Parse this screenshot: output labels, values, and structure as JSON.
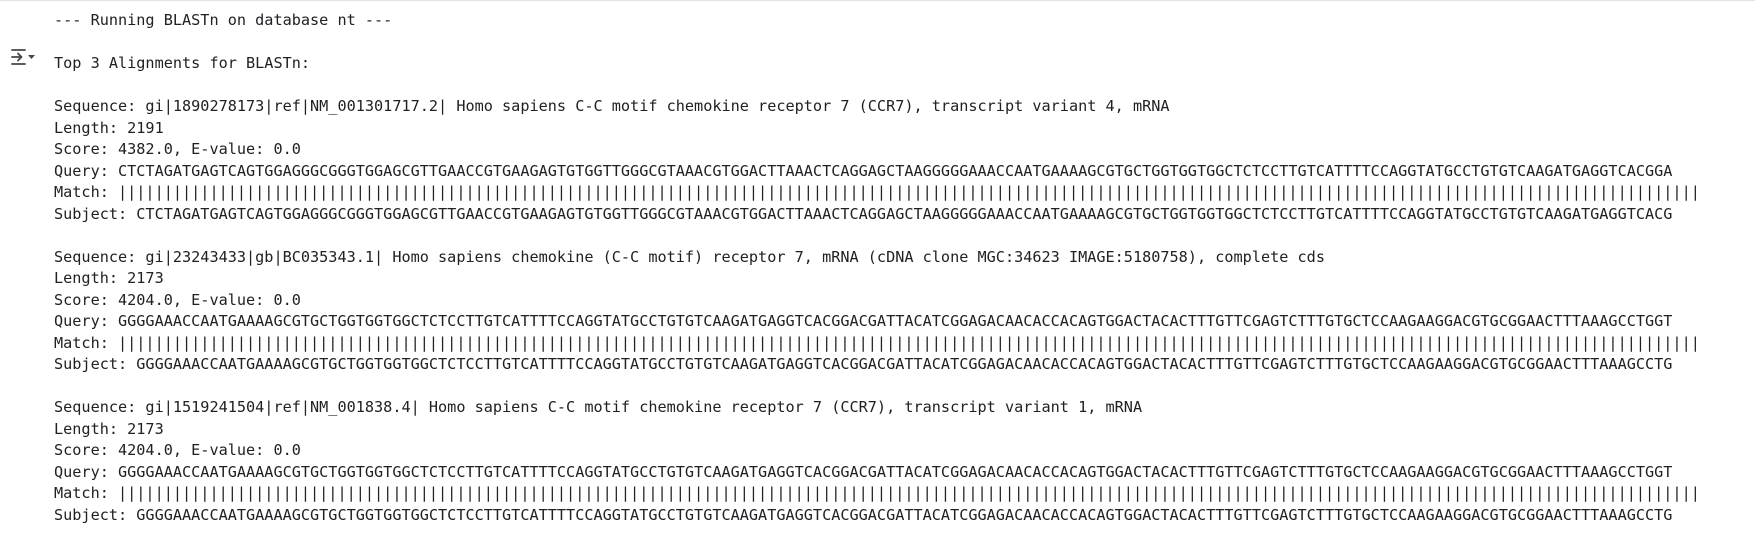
{
  "output": {
    "header": "--- Running BLASTn on database nt ---",
    "title": "Top 3 Alignments for BLASTn:",
    "alignments": [
      {
        "sequence": "Sequence: gi|1890278173|ref|NM_001301717.2| Homo sapiens C-C motif chemokine receptor 7 (CCR7), transcript variant 4, mRNA",
        "length": "Length: 2191",
        "score": "Score: 4382.0, E-value: 0.0",
        "query": "Query: CTCTAGATGAGTCAGTGGAGGGCGGGTGGAGCGTTGAACCGTGAAGAGTGTGGTTGGGCGTAAACGTGGACTTAAACTCAGGAGCTAAGGGGGAAACCAATGAAAAGCGTGCTGGTGGTGGCTCTCCTTGTCATTTTCCAGGTATGCCTGTGTCAAGATGAGGTCACGGA",
        "match": "Match: |||||||||||||||||||||||||||||||||||||||||||||||||||||||||||||||||||||||||||||||||||||||||||||||||||||||||||||||||||||||||||||||||||||||||||||||||||||||||||||||||||||||||||||",
        "subject": "Subject: CTCTAGATGAGTCAGTGGAGGGCGGGTGGAGCGTTGAACCGTGAAGAGTGTGGTTGGGCGTAAACGTGGACTTAAACTCAGGAGCTAAGGGGGAAACCAATGAAAAGCGTGCTGGTGGTGGCTCTCCTTGTCATTTTCCAGGTATGCCTGTGTCAAGATGAGGTCACG"
      },
      {
        "sequence": "Sequence: gi|23243433|gb|BC035343.1| Homo sapiens chemokine (C-C motif) receptor 7, mRNA (cDNA clone MGC:34623 IMAGE:5180758), complete cds",
        "length": "Length: 2173",
        "score": "Score: 4204.0, E-value: 0.0",
        "query": "Query: GGGGAAACCAATGAAAAGCGTGCTGGTGGTGGCTCTCCTTGTCATTTTCCAGGTATGCCTGTGTCAAGATGAGGTCACGGACGATTACATCGGAGACAACACCACAGTGGACTACACTTTGTTCGAGTCTTTGTGCTCCAAGAAGGACGTGCGGAACTTTAAAGCCTGGT",
        "match": "Match: |||||||||||||||||||||||||||||||||||||||||||||||||||||||||||||||||||||||||||||||||||||||||||||||||||||||||||||||||||||||||||||||||||||||||||||||||||||||||||||||||||||||||||||",
        "subject": "Subject: GGGGAAACCAATGAAAAGCGTGCTGGTGGTGGCTCTCCTTGTCATTTTCCAGGTATGCCTGTGTCAAGATGAGGTCACGGACGATTACATCGGAGACAACACCACAGTGGACTACACTTTGTTCGAGTCTTTGTGCTCCAAGAAGGACGTGCGGAACTTTAAAGCCTG"
      },
      {
        "sequence": "Sequence: gi|1519241504|ref|NM_001838.4| Homo sapiens C-C motif chemokine receptor 7 (CCR7), transcript variant 1, mRNA",
        "length": "Length: 2173",
        "score": "Score: 4204.0, E-value: 0.0",
        "query": "Query: GGGGAAACCAATGAAAAGCGTGCTGGTGGTGGCTCTCCTTGTCATTTTCCAGGTATGCCTGTGTCAAGATGAGGTCACGGACGATTACATCGGAGACAACACCACAGTGGACTACACTTTGTTCGAGTCTTTGTGCTCCAAGAAGGACGTGCGGAACTTTAAAGCCTGGT",
        "match": "Match: |||||||||||||||||||||||||||||||||||||||||||||||||||||||||||||||||||||||||||||||||||||||||||||||||||||||||||||||||||||||||||||||||||||||||||||||||||||||||||||||||||||||||||||",
        "subject": "Subject: GGGGAAACCAATGAAAAGCGTGCTGGTGGTGGCTCTCCTTGTCATTTTCCAGGTATGCCTGTGTCAAGATGAGGTCACGGACGATTACATCGGAGACAACACCACAGTGGACTACACTTTGTTCGAGTCTTTGTGCTCCAAGAAGGACGTGCGGAACTTTAAAGCCTG"
      }
    ]
  },
  "icons": {
    "output_toggle": "output-actions-icon"
  },
  "colors": {
    "text": "#202124",
    "icon": "#444746",
    "background": "#ffffff"
  }
}
